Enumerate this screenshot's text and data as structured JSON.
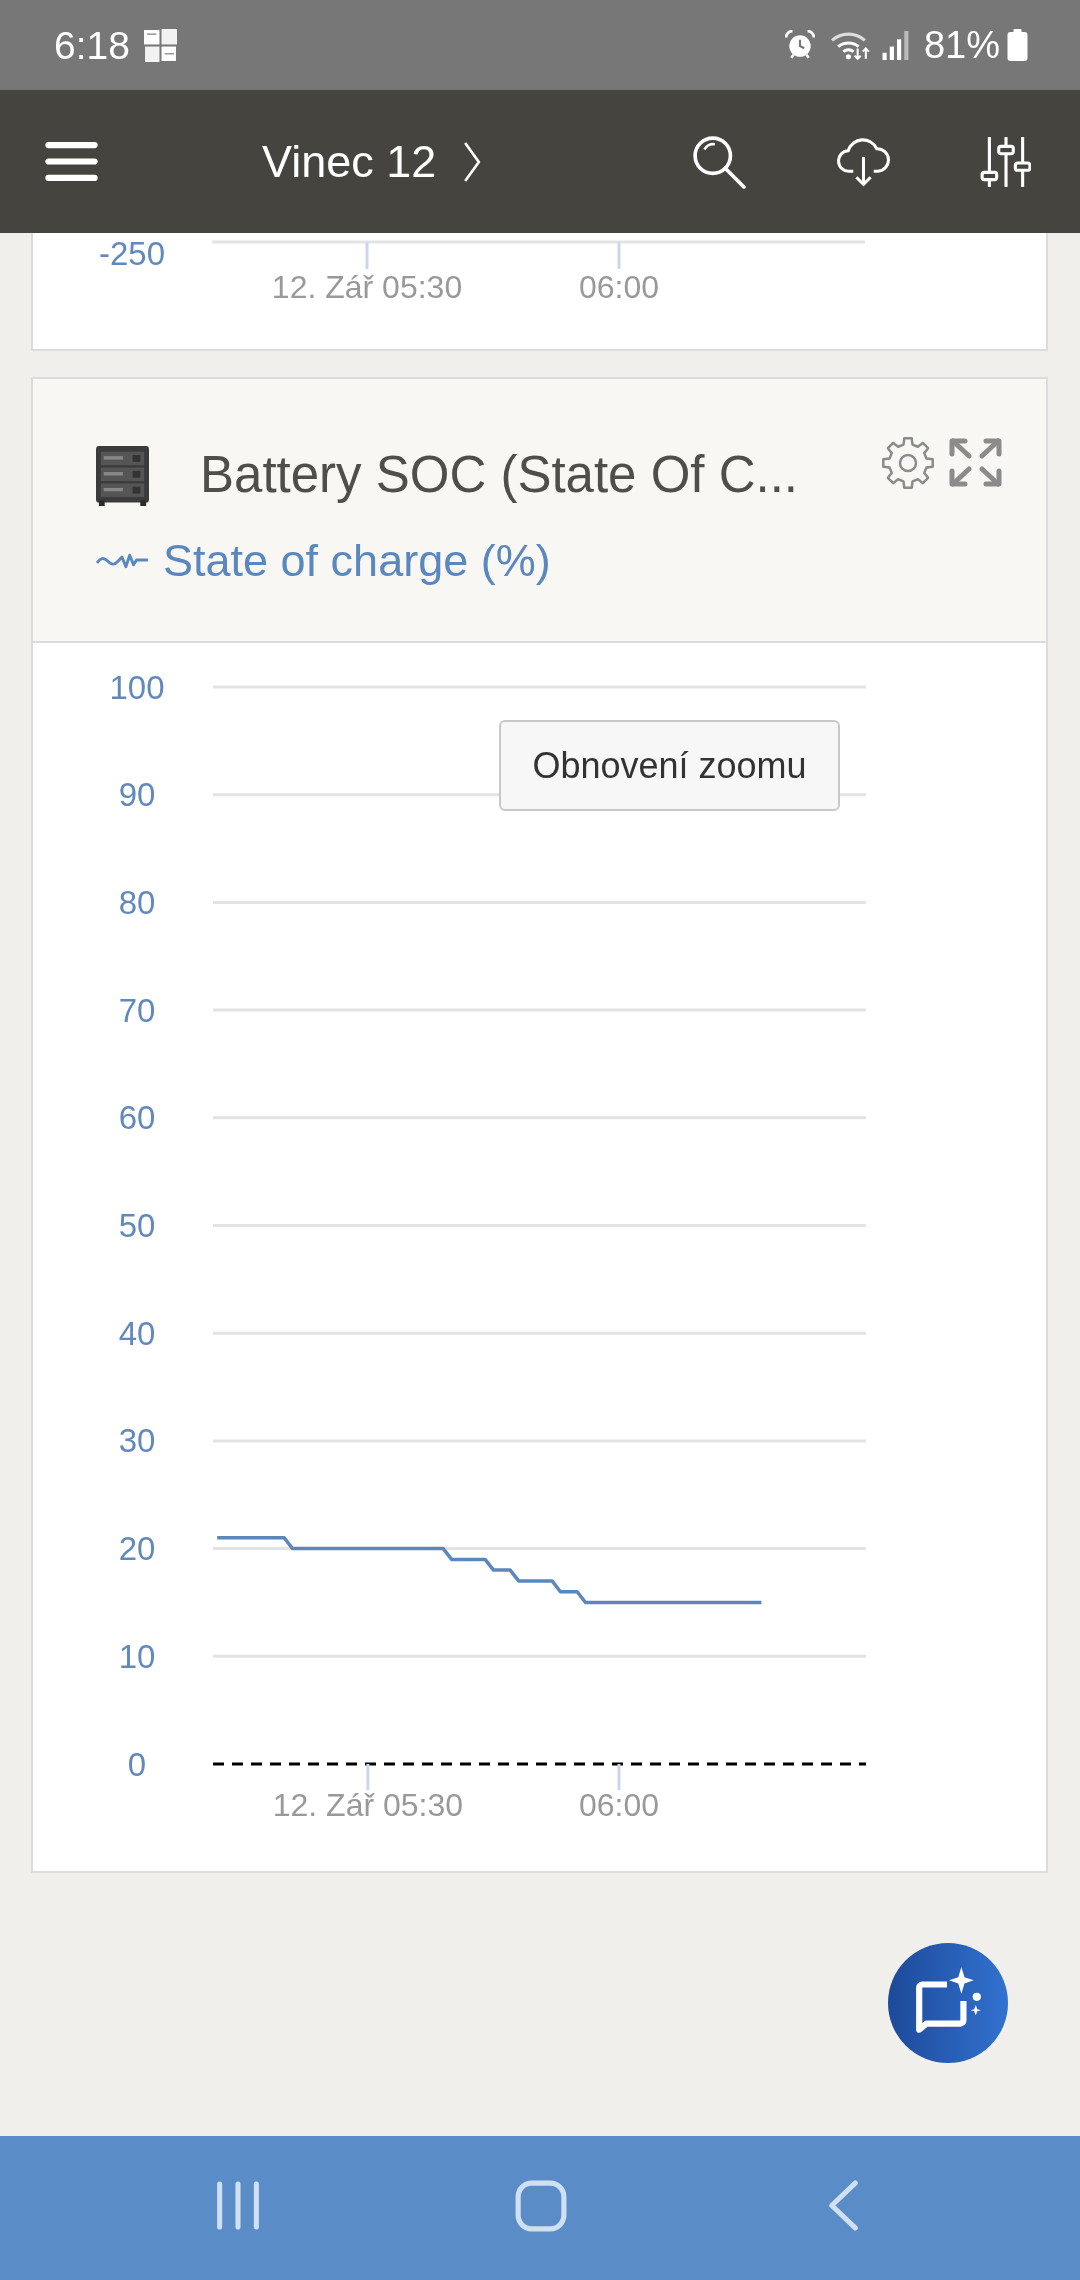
{
  "status_bar": {
    "time": "6:18",
    "battery": "81%"
  },
  "top_bar": {
    "title": "Vinec 12"
  },
  "previous_chart": {
    "y_axis_label": "-250",
    "x_axis_labels": [
      "12. Zář 05:30",
      "06:00"
    ]
  },
  "widget": {
    "title": "Battery SOC (State Of C...",
    "reset_zoom_button": "Obnovení zoomu",
    "chart_data": {
      "type": "line",
      "grid": true,
      "categories": [
        null,
        null,
        null,
        null,
        null,
        null,
        null,
        null,
        null,
        null,
        null,
        null,
        null,
        null,
        null,
        null,
        null,
        null,
        "12. Zář 05:30",
        null,
        null,
        null,
        null,
        null,
        null,
        null,
        null,
        null,
        null,
        null,
        null,
        null,
        null,
        null,
        null,
        null,
        null,
        null,
        null,
        null,
        null,
        null,
        null,
        null,
        null,
        null,
        null,
        null,
        "06:00",
        null,
        null,
        null,
        null,
        null,
        null,
        null,
        null,
        null,
        null,
        null,
        null,
        null,
        null,
        null,
        null,
        null,
        null,
        null,
        null,
        null,
        null,
        null,
        null,
        null,
        null,
        null,
        null,
        null
      ],
      "series": [
        {
          "name": "State of charge (%)",
          "color": "#5b87bf",
          "values": [
            21,
            21,
            21,
            21,
            21,
            21,
            21,
            21,
            21,
            20,
            20,
            20,
            20,
            20,
            20,
            20,
            20,
            20,
            20,
            20,
            20,
            20,
            20,
            20,
            20,
            20,
            20,
            20,
            19,
            19,
            19,
            19,
            19,
            18,
            18,
            18,
            17,
            17,
            17,
            17,
            17,
            16,
            16,
            16,
            15,
            15,
            15,
            15,
            15,
            15,
            15,
            15,
            15,
            15,
            15,
            15,
            15,
            15,
            15,
            15,
            15,
            15,
            15,
            15,
            15,
            15,
            null,
            null,
            null,
            null,
            null,
            null,
            null,
            null,
            null,
            null,
            null,
            null
          ]
        }
      ],
      "ylim": [
        0,
        100
      ],
      "yticks": [
        0,
        10,
        20,
        30,
        40,
        50,
        60,
        70,
        80,
        90,
        100
      ]
    }
  }
}
